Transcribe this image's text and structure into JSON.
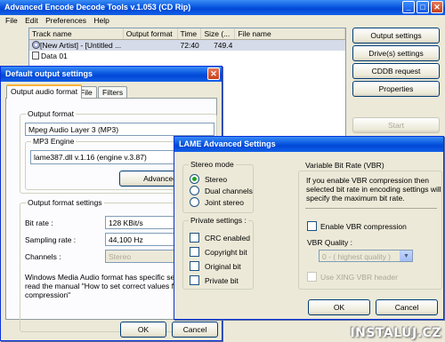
{
  "main": {
    "title": "Advanced Encode Decode Tools v.1.053 (CD Rip)",
    "menu": [
      "File",
      "Edit",
      "Preferences",
      "Help"
    ],
    "columns": [
      "Track name",
      "Output format",
      "Time",
      "Size (...",
      "File name"
    ],
    "rows": [
      {
        "name": "[New Artist] - [Untitled ...",
        "format": "",
        "time": "72:40",
        "size": "749.4",
        "file": ""
      },
      {
        "name": "Data 01",
        "format": "",
        "time": "",
        "size": "",
        "file": ""
      }
    ],
    "buttons": {
      "output_settings": "Output settings",
      "drives": "Drive(s) settings",
      "cddb": "CDDB request",
      "properties": "Properties",
      "start": "Start"
    }
  },
  "output_dialog": {
    "title": "Default output settings",
    "tabs": [
      "Output audio format",
      "File",
      "Filters"
    ],
    "output_format_group": "Output format",
    "format_value": "Mpeg Audio Layer 3 (MP3)",
    "mp3_engine_group": "MP3 Engine",
    "engine_value": "lame387.dll v.1.16 (engine v.3.87)",
    "advanced_button": "Advanced setti",
    "format_settings_group": "Output format settings",
    "bitrate_label": "Bit rate :",
    "bitrate_value": "128 KBit/s",
    "sampling_label": "Sampling rate :",
    "sampling_value": "44,100 Hz",
    "channels_label": "Channels :",
    "channels_value": "Stereo",
    "note_line1": "Windows Media Audio format has specific settings",
    "note_line2": "read the manual \"How to set correct values for WM",
    "note_line3": "compression\"",
    "ok": "OK",
    "cancel": "Cancel"
  },
  "lame_dialog": {
    "title": "LAME Advanced Settings",
    "stereo_group": "Stereo mode",
    "stereo_options": [
      {
        "label": "Stereo",
        "selected": true
      },
      {
        "label": "Dual channels",
        "selected": false
      },
      {
        "label": "Joint stereo",
        "selected": false
      }
    ],
    "private_group": "Private settings :",
    "private_options": [
      "CRC enabled",
      "Copyright bit",
      "Original bit",
      "Private bit"
    ],
    "vbr_group": "Variable Bit Rate (VBR)",
    "vbr_text_1": "If you enable VBR compression then",
    "vbr_text_2": "selected bit rate in encoding settings will",
    "vbr_text_3": "specify the maximum bit rate.",
    "enable_vbr": "Enable VBR compression",
    "vbr_quality_label": "VBR Quality :",
    "vbr_quality_value": "0 - ( highest quality )",
    "xing_label": "Use XING VBR header",
    "ok": "OK",
    "cancel": "Cancel"
  },
  "watermark": "INSTALUJ.CZ"
}
